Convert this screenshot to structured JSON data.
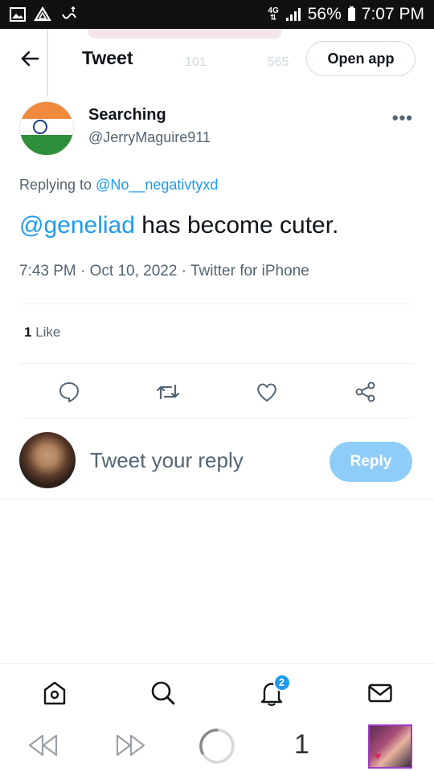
{
  "status_bar": {
    "network": "4G",
    "battery": "56%",
    "time": "7:07 PM"
  },
  "header": {
    "title": "Tweet",
    "open_app_label": "Open app",
    "ghost_retweets": "101",
    "ghost_likes": "565"
  },
  "tweet": {
    "author_name": "Searching",
    "author_handle": "@JerryMaguire911",
    "replying_prefix": "Replying to",
    "replying_to": "@No__negativtyxd",
    "mention": "@geneliad",
    "text": " has become cuter.",
    "meta": "7:43 PM · Oct 10, 2022 · Twitter for iPhone",
    "like_count": "1",
    "like_label": "Like"
  },
  "composer": {
    "placeholder": "Tweet your reply",
    "reply_label": "Reply"
  },
  "bottom_nav": {
    "notification_count": "2"
  },
  "browser": {
    "tab_count": "1"
  },
  "colors": {
    "accent": "#1d9bf0",
    "reply_button_disabled": "#8ecdf7",
    "muted_text": "#536471"
  }
}
